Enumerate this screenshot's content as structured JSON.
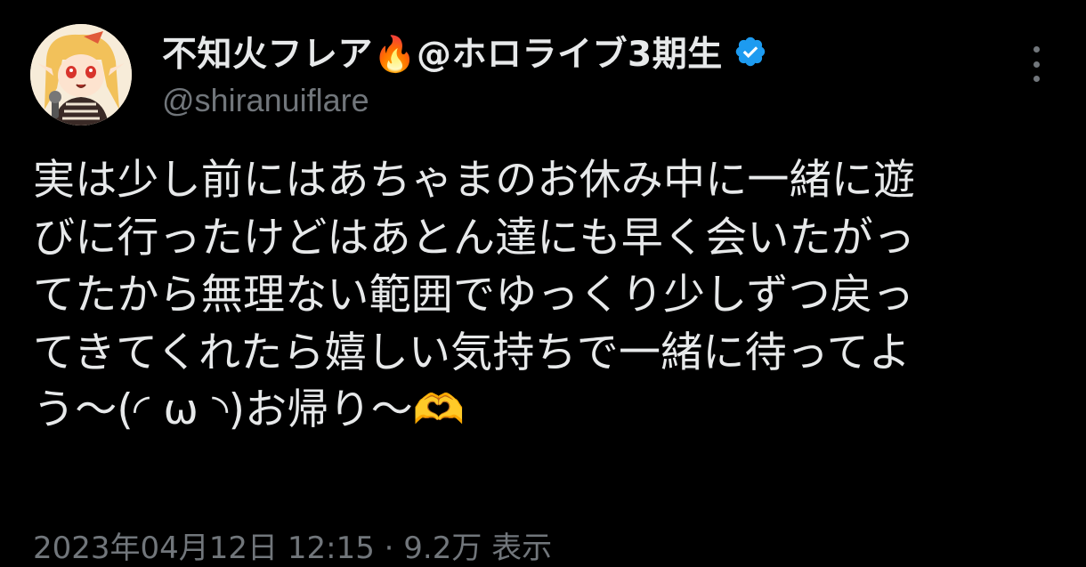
{
  "tweet": {
    "display_name": "不知火フレア🔥@ホロライブ3期生",
    "handle": "@shiranuiflare",
    "body_lines": [
      "実は少し前にはあちゃまのお休み中に一緒に遊",
      "びに行ったけどはあとん達にも早く会いたがっ",
      "てたから無理ない範囲でゆっくり少しずつ戻っ",
      "てきてくれたら嬉しい気持ちで一緒に待ってよ",
      "う〜(◜ ω ◝)お帰り〜🫶"
    ],
    "meta_partial": "2023年04月12日 12:15 · 9.2万 表示"
  },
  "icons": {
    "avatar": "avatar",
    "verified": "verified-badge-icon",
    "more": "more-options-icon"
  },
  "colors": {
    "background": "#000000",
    "text": "#e7e9ea",
    "secondary": "#71767b",
    "verified": "#1d9bf0"
  }
}
